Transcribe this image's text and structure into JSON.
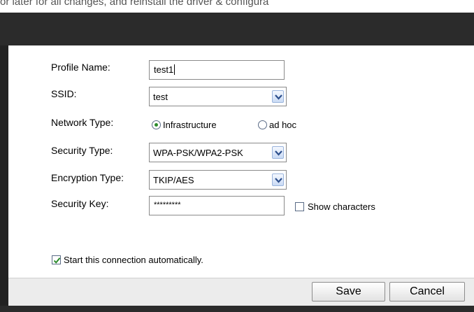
{
  "caption_fragment": "or later for all changes, and reinstall the driver & configura",
  "form": {
    "profile_name": {
      "label": "Profile Name:",
      "value": "test1"
    },
    "ssid": {
      "label": "SSID:",
      "value": "test"
    },
    "network_type": {
      "label": "Network Type:",
      "options": [
        "Infrastructure",
        "ad hoc"
      ],
      "selected": "Infrastructure"
    },
    "security_type": {
      "label": "Security Type:",
      "value": "WPA-PSK/WPA2-PSK"
    },
    "encryption_type": {
      "label": "Encryption Type:",
      "value": "TKIP/AES"
    },
    "security_key": {
      "label": "Security Key:",
      "value": "*********",
      "show_label": "Show characters",
      "show_checked": false
    },
    "auto_connect": {
      "label": "Start this connection automatically.",
      "checked": true
    }
  },
  "buttons": {
    "save": "Save",
    "cancel": "Cancel"
  },
  "colors": {
    "window_frame": "#222222",
    "radio_selected": "#2a8a2a",
    "checkmark": "#2a8a2a",
    "dropdown_arrow": "#2d4f8c"
  }
}
